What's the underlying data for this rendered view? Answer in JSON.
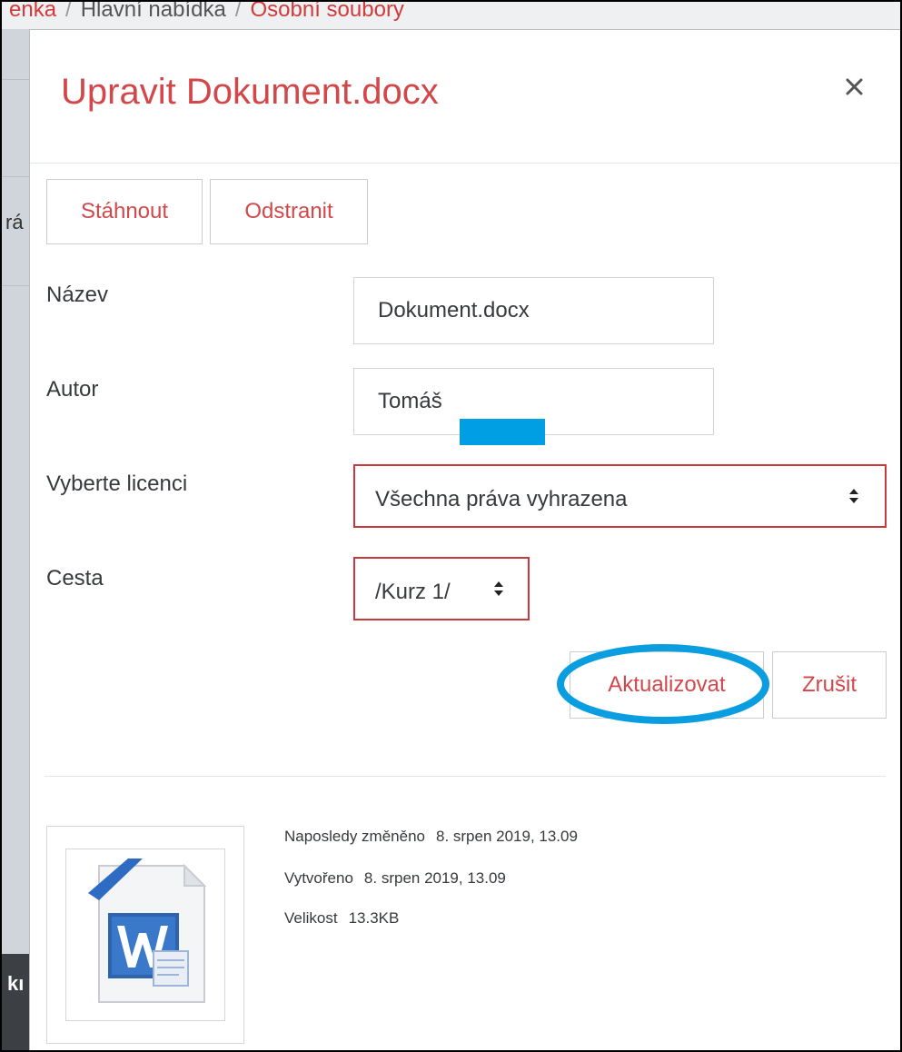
{
  "background": {
    "breadcrumb": [
      "enka",
      "Hlavní nabídka",
      "Osobní soubory"
    ],
    "side_text": "rá",
    "footer_text": "kı"
  },
  "dialog": {
    "title": "Upravit Dokument.docx",
    "close_icon": "close-icon",
    "actions": {
      "download_label": "Stáhnout",
      "delete_label": "Odstranit"
    },
    "form": {
      "name_label": "Název",
      "name_value": "Dokument.docx",
      "author_label": "Autor",
      "author_value": "Tomáš",
      "license_label": "Vyberte licenci",
      "license_value": "Všechna práva vyhrazena",
      "path_label": "Cesta",
      "path_value": "/Kurz 1/"
    },
    "buttons": {
      "update_label": "Aktualizovat",
      "cancel_label": "Zrušit"
    },
    "file_info": {
      "icon": "word-document-icon",
      "modified_label": "Naposledy změněno",
      "modified_value": "8. srpen 2019, 13.09",
      "created_label": "Vytvořeno",
      "created_value": "8. srpen 2019, 13.09",
      "size_label": "Velikost",
      "size_value": "13.3KB"
    }
  },
  "colors": {
    "accent": "#d2484a",
    "highlight_ring": "#0a9ee0",
    "redaction": "#009fe3"
  }
}
